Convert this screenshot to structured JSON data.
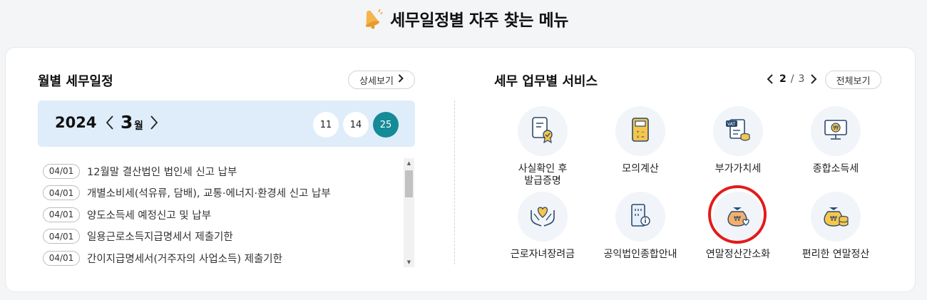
{
  "header": {
    "title": "세무일정별 자주 찾는 메뉴"
  },
  "schedule": {
    "title": "월별 세무일정",
    "detail_label": "상세보기",
    "year": "2024",
    "month": "3",
    "month_unit": "월",
    "days": [
      "11",
      "14",
      "25"
    ],
    "active_day": "25",
    "items": [
      {
        "date": "04/01",
        "text": "12월말 결산법인 법인세 신고 납부"
      },
      {
        "date": "04/01",
        "text": "개별소비세(석유류, 담배), 교통·에너지·환경세 신고 납부"
      },
      {
        "date": "04/01",
        "text": "양도소득세 예정신고 및 납부"
      },
      {
        "date": "04/01",
        "text": "일용근로소득지급명세서 제출기한"
      },
      {
        "date": "04/01",
        "text": "간이지급명세서(거주자의 사업소득) 제출기한"
      }
    ]
  },
  "services": {
    "title": "세무 업무별 서비스",
    "page_current": "2",
    "page_sep": "/",
    "page_total": "3",
    "all_label": "전체보기",
    "items": [
      {
        "label": "사실확인 후\n발급증명",
        "icon": "document-certificate-icon"
      },
      {
        "label": "모의계산",
        "icon": "calculator-icon"
      },
      {
        "label": "부가가치세",
        "icon": "vat-document-icon"
      },
      {
        "label": "종합소득세",
        "icon": "monitor-won-icon"
      },
      {
        "label": "근로자녀장려금",
        "icon": "hands-heart-icon"
      },
      {
        "label": "공익법인종합안내",
        "icon": "building-info-icon"
      },
      {
        "label": "연말정산간소화",
        "icon": "money-bag-heart-icon"
      },
      {
        "label": "편리한 연말정산",
        "icon": "money-bag-coins-icon"
      }
    ]
  },
  "colors": {
    "accent": "#148b97",
    "date_bar_bg": "#deedf9",
    "highlight": "#e31a1a"
  }
}
